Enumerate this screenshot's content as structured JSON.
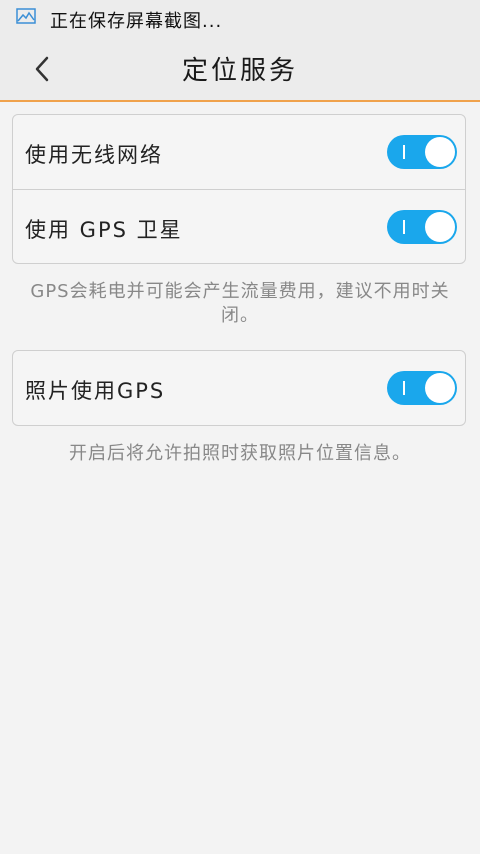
{
  "status_bar": {
    "icon": "image-icon",
    "text": "正在保存屏幕截图..."
  },
  "header": {
    "back_icon": "chevron-left-icon",
    "title": "定位服务"
  },
  "settings": {
    "wireless": {
      "label": "使用无线网络",
      "enabled": true,
      "toggle_mark": "I"
    },
    "gps_satellite": {
      "label": "使用 GPS 卫星",
      "enabled": true,
      "toggle_mark": "I"
    },
    "gps_note": "GPS会耗电并可能会产生流量费用，建议不用时关闭。",
    "photo_gps": {
      "label": "照片使用GPS",
      "enabled": true,
      "toggle_mark": "I"
    },
    "photo_note": "开启后将允许拍照时获取照片位置信息。"
  },
  "colors": {
    "accent": "#1aa7ec",
    "header_border": "#f0a24c"
  }
}
